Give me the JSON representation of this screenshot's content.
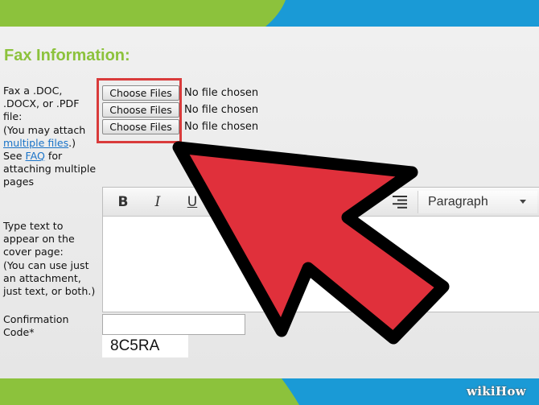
{
  "form": {
    "heading": "Fax Information:",
    "file_label_lines": [
      "Fax a .DOC,",
      ".DOCX, or .PDF",
      "file:",
      "(You may attach"
    ],
    "multiple_files_link": "multiple files",
    "after_link": ".)",
    "see": "See ",
    "faq_link": "FAQ",
    "for": " for",
    "attaching_lines": [
      "attaching multiple",
      "pages"
    ],
    "file_inputs": [
      {
        "button": "Choose Files",
        "status": "No file chosen"
      },
      {
        "button": "Choose Files",
        "status": "No file chosen"
      },
      {
        "button": "Choose Files",
        "status": "No file chosen"
      }
    ],
    "cover_label_lines": [
      "Type text to",
      "appear on the",
      "cover page:",
      "(You can use just",
      "an attachment,",
      "just text, or both.)"
    ],
    "editor": {
      "bold": "B",
      "italic": "I",
      "underline": "U",
      "format_select": "Paragraph"
    },
    "confirmation_label_lines": [
      "Confirmation",
      "Code*"
    ],
    "captcha": "8C5RA"
  },
  "watermark": "wikiHow",
  "colors": {
    "brand_green": "#8cc23c",
    "brand_blue": "#1a9ad6",
    "arrow_red": "#e0303b",
    "highlight_red": "#d93b3b",
    "link_blue": "#1a73c8"
  },
  "icons": [
    "bold-icon",
    "italic-icon",
    "underline-icon",
    "align-right-icon",
    "dropdown-caret-icon",
    "arrow-pointer"
  ]
}
